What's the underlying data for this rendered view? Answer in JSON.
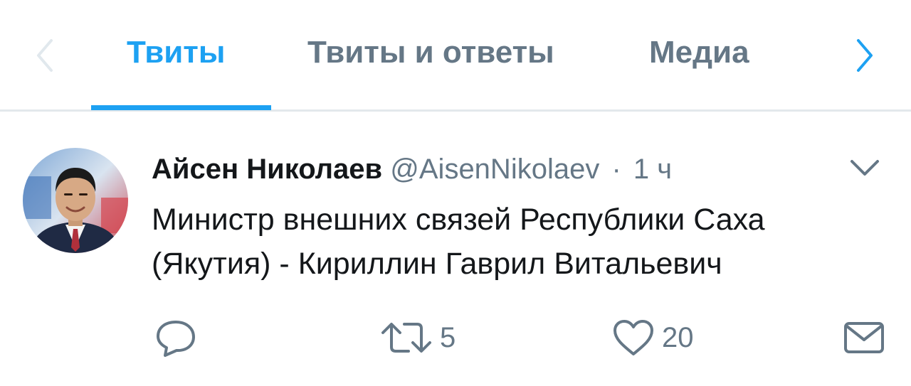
{
  "tabs": {
    "items": [
      {
        "label": "Твиты",
        "active": true
      },
      {
        "label": "Твиты и ответы",
        "active": false
      },
      {
        "label": "Медиа",
        "active": false
      }
    ],
    "prev_icon": "chevron-left-icon",
    "next_icon": "chevron-right-icon"
  },
  "tweet": {
    "author_name": "Айсен Николаев",
    "author_handle": "@AisenNikolaev",
    "separator": "·",
    "time": "1 ч",
    "text": "Министр внешних связей Республики Саха (Якутия) - Кириллин Гаврил Витальевич",
    "actions": {
      "reply_count": "",
      "retweet_count": "5",
      "like_count": "20"
    }
  },
  "colors": {
    "accent": "#1da1f2",
    "secondary_text": "#657786",
    "primary_text": "#14171a",
    "divider": "#e3e8ec"
  }
}
